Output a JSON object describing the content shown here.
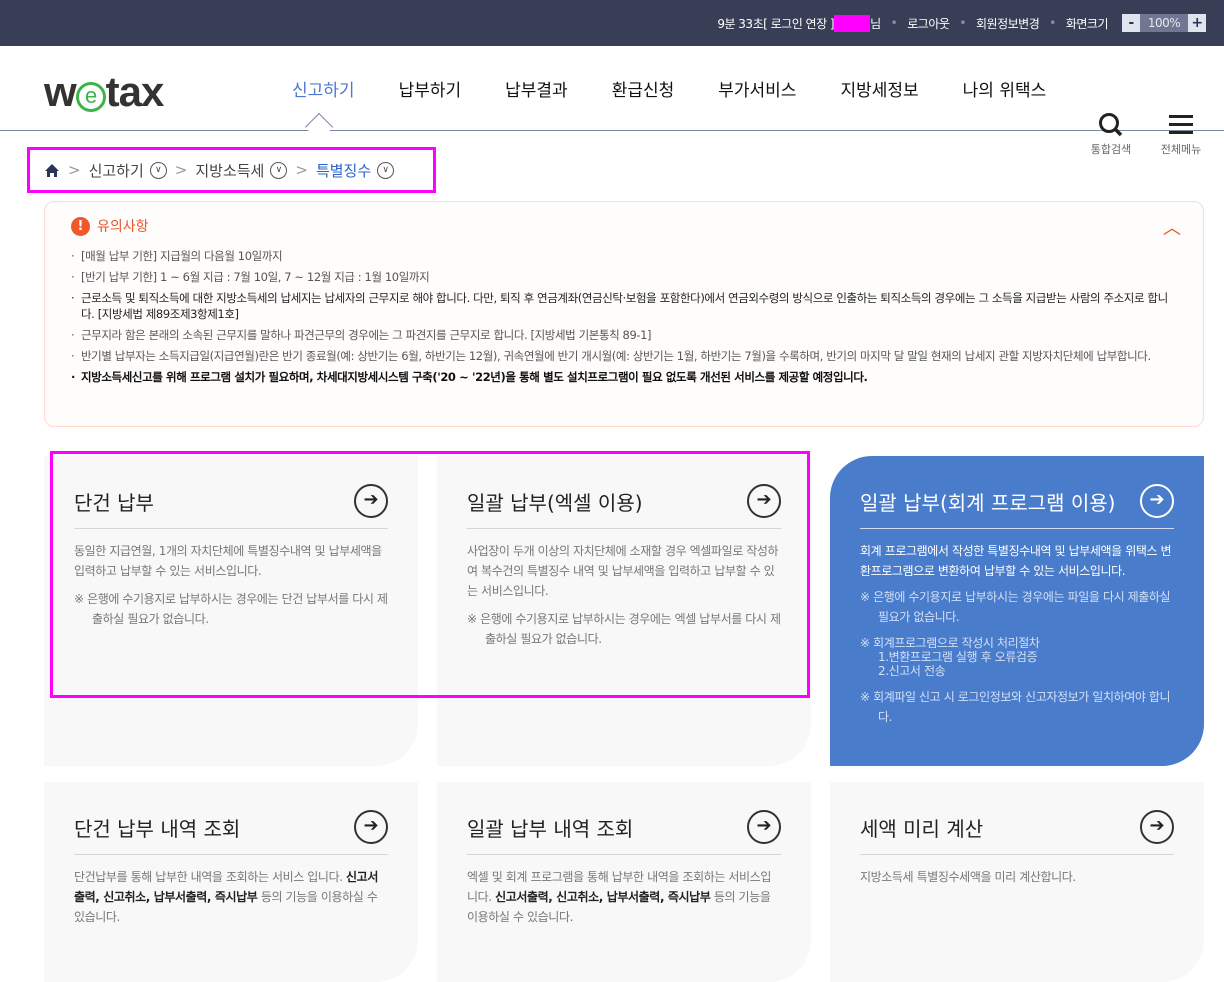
{
  "topbar": {
    "timer": "9분 33초[ 로그인 연장 ]",
    "suffix": "님",
    "logout": "로그아웃",
    "member": "회원정보변경",
    "screen": "화면크기",
    "minus": "-",
    "zoom": "100%",
    "plus": "+"
  },
  "header": {
    "logo_w": "w",
    "logo_e": "e",
    "logo_tax": "tax",
    "nav": [
      "신고하기",
      "납부하기",
      "납부결과",
      "환급신청",
      "부가서비스",
      "지방세정보",
      "나의 위택스"
    ],
    "search": "통합검색",
    "menu": "전체메뉴"
  },
  "breadcrumb": {
    "items": [
      "신고하기",
      "지방소득세",
      "특별징수"
    ]
  },
  "notice": {
    "title": "유의사항",
    "items": [
      "[매월 납부 기한] 지급월의 다음월 10일까지",
      "[반기 납부 기한] 1 ~ 6월 지급 : 7월 10일, 7 ~ 12월 지급 : 1월 10일까지",
      "근로소득 및 퇴직소득에 대한 지방소득세의 납세지는 납세자의 근무지로 해야 합니다. 다만, 퇴직 후 연금계좌(연금신탁·보험을 포함한다)에서 연금외수령의 방식으로 인출하는 퇴직소득의 경우에는 그 소득을 지급받는 사람의 주소지로 합니다. [지방세법 제89조제3항제1호]",
      "근무지라 함은 본래의 소속된 근무지를 말하나 파견근무의 경우에는 그 파견지를 근무지로 합니다. [지방세법 기본통칙 89-1]",
      "반기별 납부자는 소득지급일(지급연월)란은 반기 종료월(예: 상반기는 6월, 하반기는 12월), 귀속연월에 반기 개시월(예: 상반기는 1월, 하반기는 7월)을 수록하며, 반기의 마지막 달 말일 현재의 납세지 관할 지방자치단체에 납부합니다.",
      "지방소득세신고를 위해 프로그램 설치가 필요하며, 차세대지방세시스템 구축('20 ~ '22년)을 통해 별도 설치프로그램이 필요 없도록 개선된 서비스를 제공할 예정입니다."
    ]
  },
  "cards": [
    {
      "title": "단건 납부",
      "desc": "동일한 지급연월, 1개의 자치단체에 특별징수내역 및 납부세액을 입력하고 납부할 수 있는 서비스입니다.",
      "notes": [
        "※ 은행에 수기용지로 납부하시는 경우에는 단건 납부서를 다시 제출하실 필요가 없습니다."
      ]
    },
    {
      "title": "일괄 납부(엑셀 이용)",
      "desc": "사업장이 두개 이상의 자치단체에 소재할 경우 엑셀파일로 작성하여 복수건의 특별징수 내역 및 납부세액을 입력하고 납부할 수 있는 서비스입니다.",
      "notes": [
        "※ 은행에 수기용지로 납부하시는 경우에는 엑셀 납부서를 다시 제출하실 필요가 없습니다."
      ]
    },
    {
      "title": "일괄 납부(회계 프로그램 이용)",
      "desc": "회계 프로그램에서 작성한 특별징수내역 및 납부세액을 위택스 변환프로그램으로 변환하여 납부할 수 있는 서비스입니다.",
      "notes": [
        "※ 은행에 수기용지로 납부하시는 경우에는 파일을 다시 제출하실 필요가 없습니다.",
        "※ 회계프로그램으로 작성시 처리절차",
        "1.변환프로그램 실행 후 오류검증",
        "2.신고서 전송",
        "※ 회계파일 신고 시 로그인정보와 신고자정보가 일치하여야 합니다."
      ]
    },
    {
      "title": "단건 납부 내역 조회",
      "desc_pre": "단건납부를 통해 납부한 내역을 조회하는 서비스 입니다.",
      "desc_bold": "신고서출력, 신고취소, 납부서출력, 즉시납부",
      "desc_post": " 등의 기능을 이용하실 수 있습니다."
    },
    {
      "title": "일괄 납부 내역 조회",
      "desc_pre": "엑셀 및 회계 프로그램을 통해 납부한 내역을 조회하는 서비스입니다. ",
      "desc_bold": "신고서출력, 신고취소, 납부서출력, 즉시납부",
      "desc_post": " 등의 기능을 이용하실 수 있습니다."
    },
    {
      "title": "세액 미리 계산",
      "desc": "지방소득세 특별징수세액을 미리 계산합니다."
    }
  ],
  "arrow": "➔"
}
